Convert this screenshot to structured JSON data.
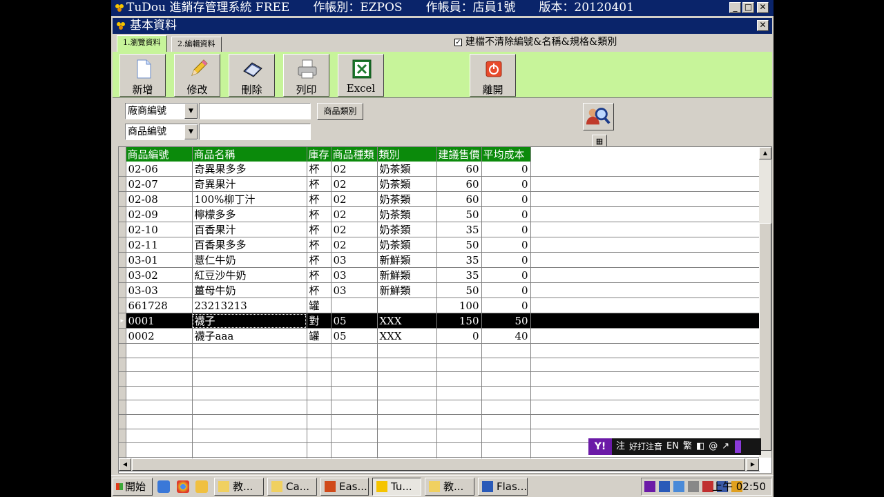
{
  "app": {
    "title": "TuDou 進銷存管理系統 FREE　　作帳別：EZPOS　　作帳員：店員1號　　版本：20120401"
  },
  "window": {
    "title": "基本資料"
  },
  "tabs": [
    {
      "label": "1.瀏覽資料",
      "active": true
    },
    {
      "label": "2.編輯資料",
      "active": false
    }
  ],
  "option": {
    "checked": true,
    "label": "建檔不清除編號&名稱&規格&類別"
  },
  "toolbar": {
    "add": "新增",
    "edit": "修改",
    "delete": "刪除",
    "print": "列印",
    "excel": "Excel",
    "exit": "離開"
  },
  "filter": {
    "field1": "廠商編號",
    "field2": "商品編號",
    "value1": "",
    "value2": "",
    "category_button": "商品類別"
  },
  "grid": {
    "columns": [
      "商品編號",
      "商品名稱",
      "庫存",
      "商品種類",
      "類別",
      "建議售價",
      "平均成本"
    ],
    "rows": [
      [
        "02-06",
        "奇異果多多",
        "杯",
        "02",
        "奶茶類",
        "60",
        "0"
      ],
      [
        "02-07",
        "奇異果汁",
        "杯",
        "02",
        "奶茶類",
        "60",
        "0"
      ],
      [
        "02-08",
        "100%柳丁汁",
        "杯",
        "02",
        "奶茶類",
        "60",
        "0"
      ],
      [
        "02-09",
        "檸檬多多",
        "杯",
        "02",
        "奶茶類",
        "50",
        "0"
      ],
      [
        "02-10",
        "百香果汁",
        "杯",
        "02",
        "奶茶類",
        "35",
        "0"
      ],
      [
        "02-11",
        "百香果多多",
        "杯",
        "02",
        "奶茶類",
        "50",
        "0"
      ],
      [
        "03-01",
        "薏仁牛奶",
        "杯",
        "03",
        "新鮮類",
        "35",
        "0"
      ],
      [
        "03-02",
        "紅豆沙牛奶",
        "杯",
        "03",
        "新鮮類",
        "35",
        "0"
      ],
      [
        "03-03",
        "薑母牛奶",
        "杯",
        "03",
        "新鮮類",
        "50",
        "0"
      ],
      [
        "661728",
        "23213213",
        "罐",
        "",
        "",
        "100",
        "0"
      ],
      [
        "0001",
        "襪子",
        "對",
        "05",
        "XXX",
        "150",
        "50"
      ],
      [
        "0002",
        "襪子aaa",
        "罐",
        "05",
        "XXX",
        "0",
        "40"
      ]
    ],
    "selected_index": 10,
    "empty_rows": 9
  },
  "ime": {
    "label": "注",
    "mode": "好打注音",
    "lang": "EN",
    "variant": "繁"
  },
  "taskbar": {
    "start": "開始",
    "tasks": [
      {
        "label": "教...",
        "icon": "folder-icon",
        "active": false
      },
      {
        "label": "Ca...",
        "icon": "folder-icon",
        "active": false
      },
      {
        "label": "Eas...",
        "icon": "app-icon",
        "active": false
      },
      {
        "label": "Tu...",
        "icon": "tudou-icon",
        "active": true
      },
      {
        "label": "教...",
        "icon": "folder-icon",
        "active": false
      },
      {
        "label": "Flas...",
        "icon": "flash-icon",
        "active": false
      }
    ],
    "clock": "上午 02:50"
  },
  "colors": {
    "titlebar": "#0a246a",
    "toolbar_bg": "#c7f49a",
    "header_bg": "#0b8a0b",
    "selected_row": "#000000"
  }
}
